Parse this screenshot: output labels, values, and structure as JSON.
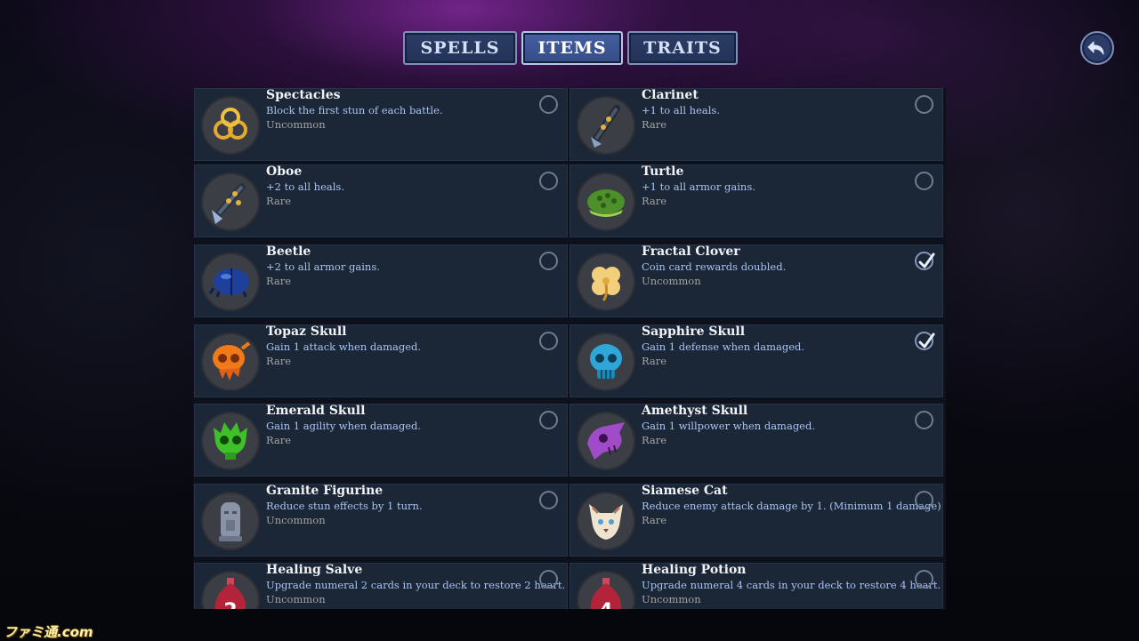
{
  "tabs": [
    {
      "label": "SPELLS",
      "active": false
    },
    {
      "label": "ITEMS",
      "active": true
    },
    {
      "label": "TRAITS",
      "active": false
    }
  ],
  "back_icon": "back-arrow-icon",
  "colors": {
    "card_bg": "#1b2637",
    "name": "#f1f3f6",
    "description": "#a9c4f2",
    "rarity": "#a6a5a1",
    "tab_active": "#3d5594",
    "tab_inactive": "#263759"
  },
  "items": [
    {
      "name": "Spectacles",
      "description": "Block the first stun of each battle.",
      "rarity": "Uncommon",
      "selected": false,
      "icon": "spectacles-icon"
    },
    {
      "name": "Clarinet",
      "description": "+1 to all heals.",
      "rarity": "Rare",
      "selected": false,
      "icon": "clarinet-icon"
    },
    {
      "name": "Oboe",
      "description": "+2 to all heals.",
      "rarity": "Rare",
      "selected": false,
      "icon": "oboe-icon"
    },
    {
      "name": "Turtle",
      "description": "+1 to all armor gains.",
      "rarity": "Rare",
      "selected": false,
      "icon": "turtle-icon"
    },
    {
      "name": "Beetle",
      "description": "+2 to all armor gains.",
      "rarity": "Rare",
      "selected": false,
      "icon": "beetle-icon"
    },
    {
      "name": "Fractal Clover",
      "description": "Coin card rewards doubled.",
      "rarity": "Uncommon",
      "selected": true,
      "icon": "clover-icon"
    },
    {
      "name": "Topaz Skull",
      "description": "Gain 1 attack when damaged.",
      "rarity": "Rare",
      "selected": false,
      "icon": "topaz-skull-icon"
    },
    {
      "name": "Sapphire Skull",
      "description": "Gain 1 defense when damaged.",
      "rarity": "Rare",
      "selected": true,
      "icon": "sapphire-skull-icon"
    },
    {
      "name": "Emerald Skull",
      "description": "Gain 1 agility when damaged.",
      "rarity": "Rare",
      "selected": false,
      "icon": "emerald-skull-icon"
    },
    {
      "name": "Amethyst Skull",
      "description": "Gain 1 willpower when damaged.",
      "rarity": "Rare",
      "selected": false,
      "icon": "amethyst-skull-icon"
    },
    {
      "name": "Granite Figurine",
      "description": "Reduce stun effects by 1 turn.",
      "rarity": "Uncommon",
      "selected": false,
      "icon": "granite-figurine-icon"
    },
    {
      "name": "Siamese Cat",
      "description": "Reduce enemy attack damage by 1. (Minimum 1 damage)",
      "rarity": "Rare",
      "selected": false,
      "icon": "cat-icon"
    },
    {
      "name": "Healing Salve",
      "description": "Upgrade numeral 2 cards in your deck to restore 2 heart.",
      "rarity": "Uncommon",
      "selected": false,
      "icon": "salve-flask-icon",
      "icon_text": "2"
    },
    {
      "name": "Healing Potion",
      "description": "Upgrade numeral 4 cards in your deck to restore 4 heart.",
      "rarity": "Uncommon",
      "selected": false,
      "icon": "potion-flask-icon",
      "icon_text": "4"
    }
  ],
  "watermark": "ファミ通.com"
}
